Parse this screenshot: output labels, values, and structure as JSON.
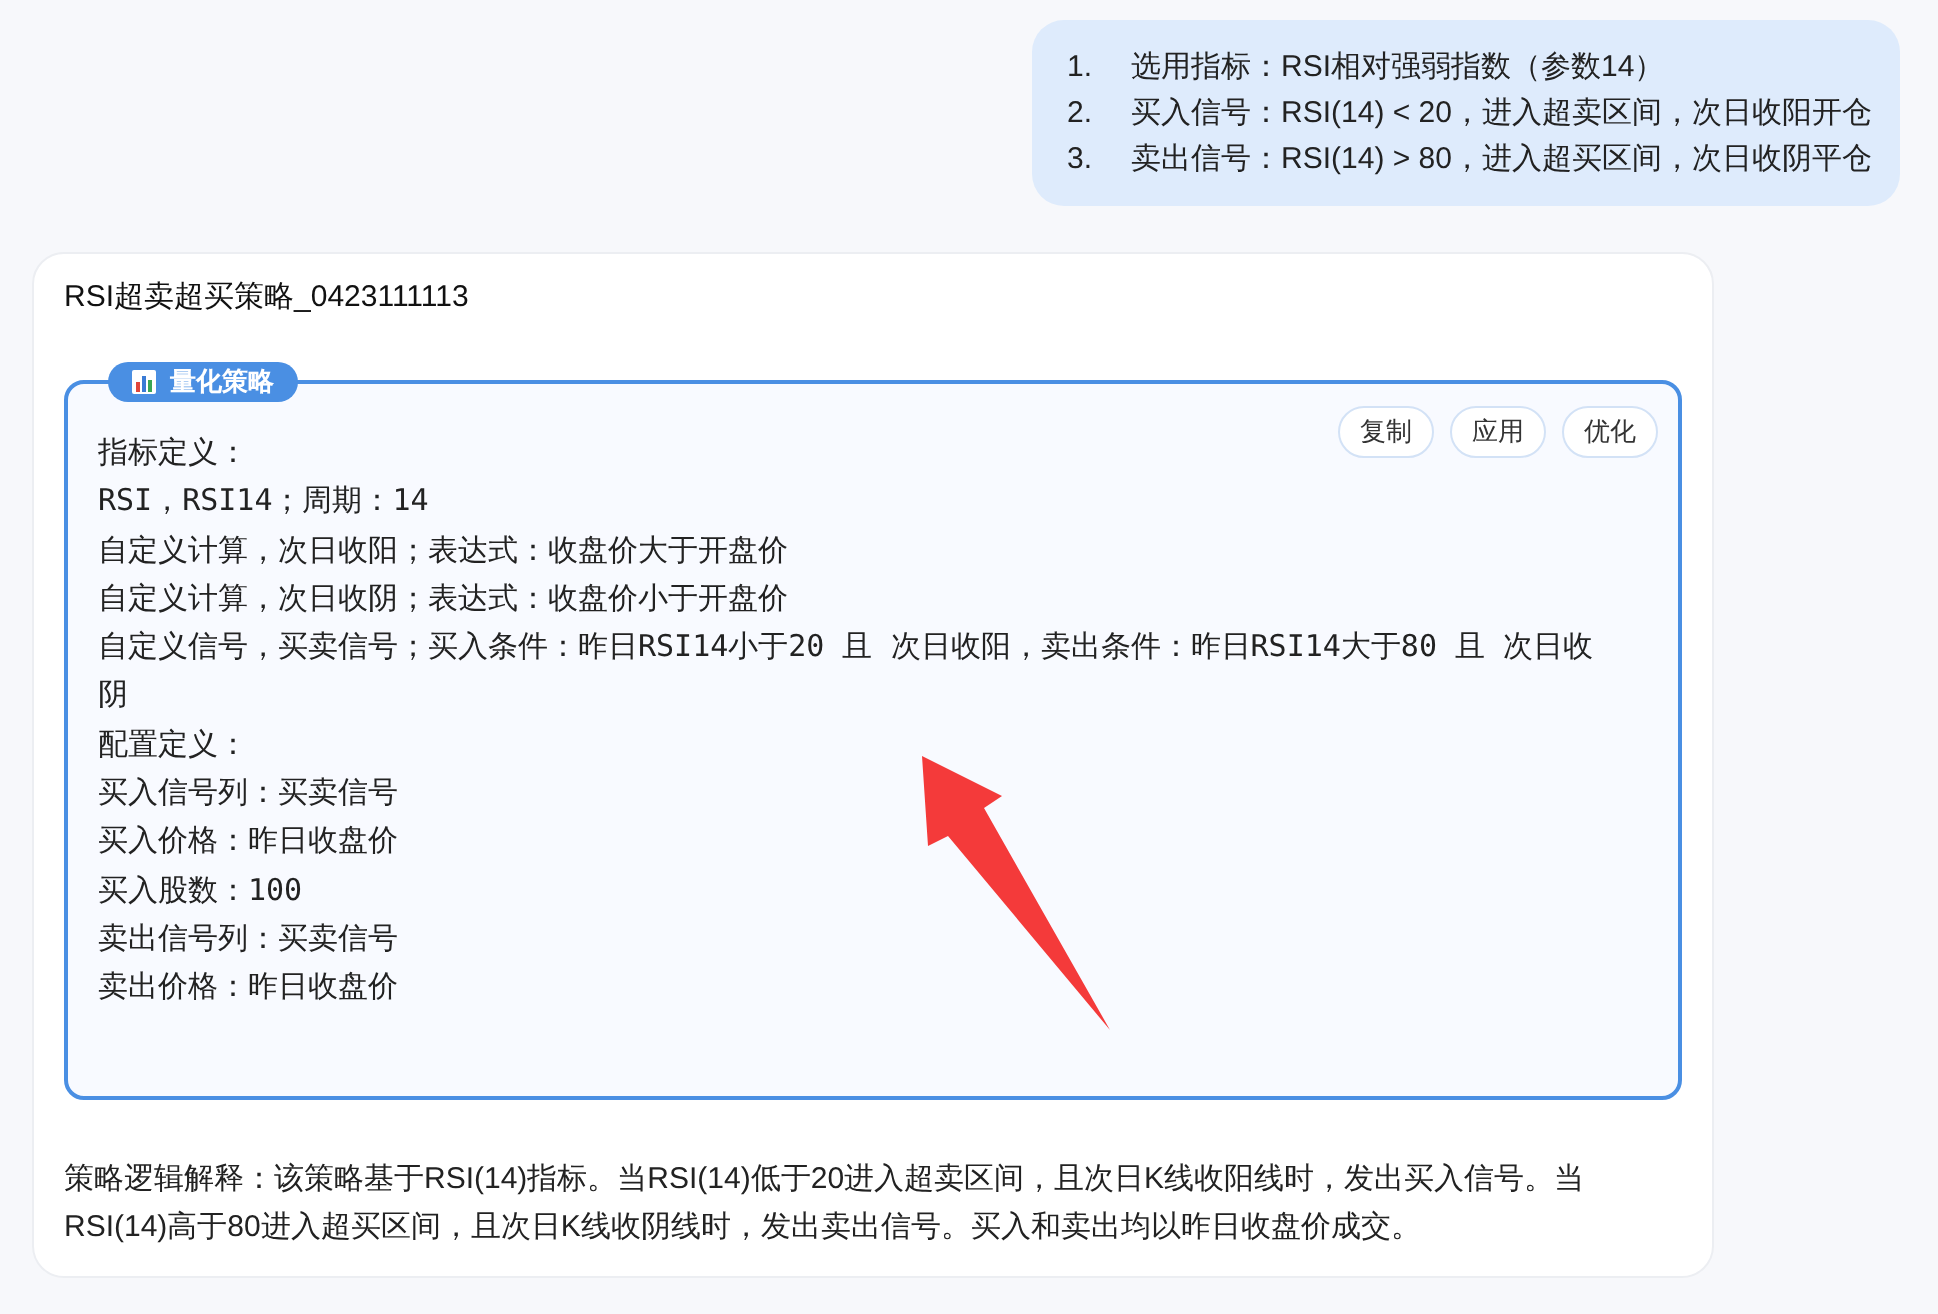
{
  "user_message": {
    "items": [
      {
        "number": "1.",
        "text": "选用指标：RSI相对强弱指数（参数14）"
      },
      {
        "number": "2.",
        "text": "买入信号：RSI(14) < 20，进入超卖区间，次日收阳开仓"
      },
      {
        "number": "3.",
        "text": "卖出信号：RSI(14) > 80，进入超买区间，次日收阴平仓"
      }
    ]
  },
  "assistant_message": {
    "title": "RSI超卖超买策略_0423111113",
    "strategy_panel": {
      "badge": "量化策略",
      "buttons": [
        "复制",
        "应用",
        "优化"
      ],
      "lines": [
        "指标定义：",
        "RSI，RSI14；周期：14",
        "自定义计算，次日收阳；表达式：收盘价大于开盘价",
        "自定义计算，次日收阴；表达式：收盘价小于开盘价",
        "自定义信号，买卖信号；买入条件：昨日RSI14小于20 且 次日收阳，卖出条件：昨日RSI14大于80 且 次日收阴",
        "配置定义：",
        "买入信号列：买卖信号",
        "买入价格：昨日收盘价",
        "买入股数：100",
        "卖出信号列：买卖信号",
        "卖出价格：昨日收盘价"
      ]
    },
    "explanation": "策略逻辑解释：该策略基于RSI(14)指标。当RSI(14)低于20进入超卖区间，且次日K线收阳线时，发出买入信号。当RSI(14)高于80进入超买区间，且次日K线收阴线时，发出卖出信号。买入和卖出均以昨日收盘价成交。"
  }
}
